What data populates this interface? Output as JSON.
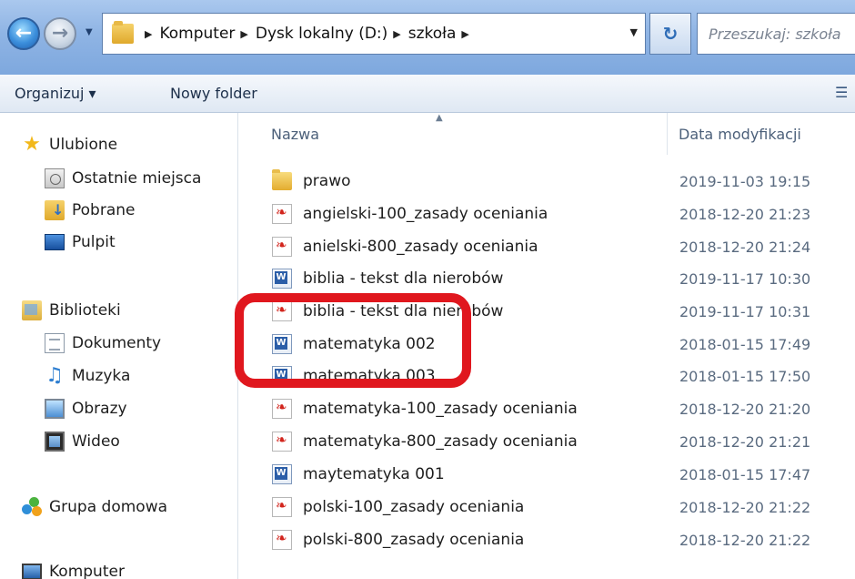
{
  "address_bar": {
    "breadcrumbs": [
      "Komputer",
      "Dysk lokalny (D:)",
      "szkoła"
    ],
    "search_placeholder": "Przeszukaj: szkoła",
    "search_display": "Przeszukaj: szkoła"
  },
  "toolbar": {
    "organize_label": "Organizuj ▾",
    "new_folder_label": "Nowy folder"
  },
  "nav_pane": {
    "favorites": {
      "label": "Ulubione",
      "items": [
        "Ostatnie miejsca",
        "Pobrane",
        "Pulpit"
      ]
    },
    "libraries": {
      "label": "Biblioteki",
      "items": [
        "Dokumenty",
        "Muzyka",
        "Obrazy",
        "Wideo"
      ]
    },
    "homegroup": "Grupa domowa",
    "computer": "Komputer"
  },
  "file_list": {
    "columns": {
      "name": "Nazwa",
      "date": "Data modyfikacji"
    },
    "rows": [
      {
        "name": "prawo",
        "type": "folder",
        "date": "2019-11-03 19:15"
      },
      {
        "name": "angielski-100_zasady oceniania",
        "type": "pdf",
        "date": "2018-12-20 21:23"
      },
      {
        "name": "anielski-800_zasady oceniania",
        "type": "pdf",
        "date": "2018-12-20 21:24"
      },
      {
        "name": "biblia - tekst dla nierobów",
        "type": "word",
        "date": "2019-11-17 10:30"
      },
      {
        "name": "biblia - tekst dla nierobów",
        "type": "pdf",
        "date": "2019-11-17 10:31"
      },
      {
        "name": "matematyka 002",
        "type": "word",
        "date": "2018-01-15 17:49"
      },
      {
        "name": "matematyka 003",
        "type": "word",
        "date": "2018-01-15 17:50"
      },
      {
        "name": "matematyka-100_zasady oceniania",
        "type": "pdf",
        "date": "2018-12-20 21:20"
      },
      {
        "name": "matematyka-800_zasady oceniania",
        "type": "pdf",
        "date": "2018-12-20 21:21"
      },
      {
        "name": "maytematyka 001",
        "type": "word",
        "date": "2018-01-15 17:47"
      },
      {
        "name": "polski-100_zasady oceniania",
        "type": "pdf",
        "date": "2018-12-20 21:22"
      },
      {
        "name": "polski-800_zasady oceniania",
        "type": "pdf",
        "date": "2018-12-20 21:22"
      }
    ]
  },
  "icons": {
    "back": "back-arrow-icon",
    "forward": "forward-arrow-icon",
    "refresh": "refresh-icon",
    "favorites": "star-icon",
    "folder": "folder-icon",
    "pdf": "pdf-file-icon",
    "word": "word-document-icon"
  },
  "colors": {
    "annotation": "#e0171e",
    "address_bar": "#8fb4e4",
    "date_text": "#5a6b80"
  }
}
